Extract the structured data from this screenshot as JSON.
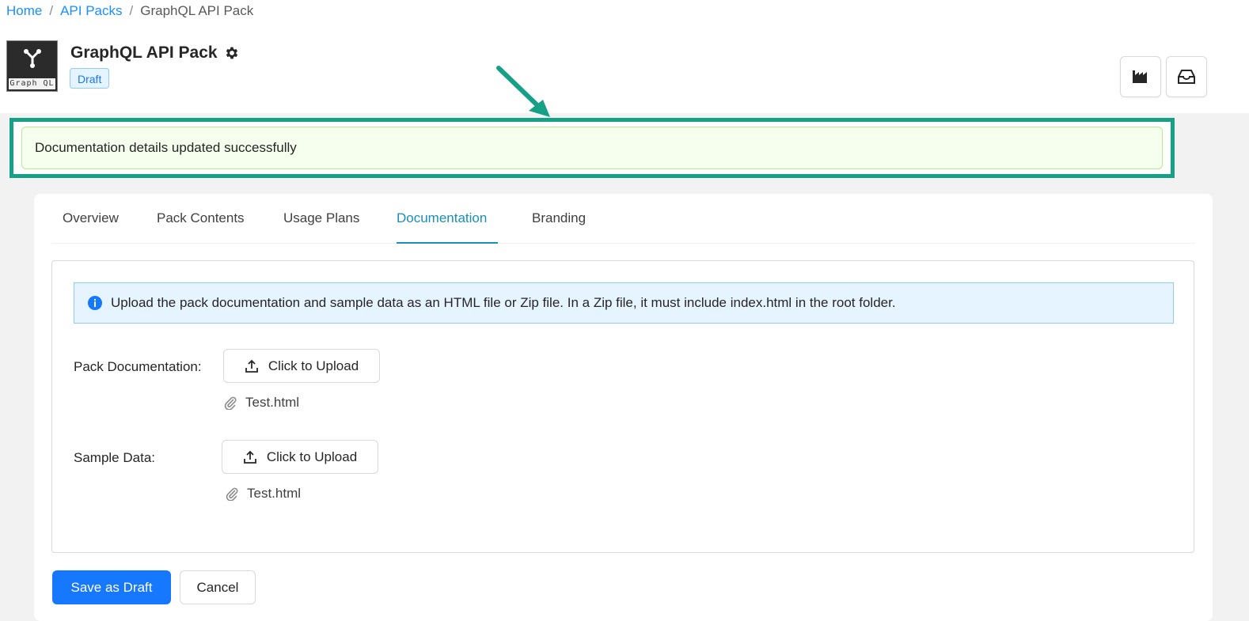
{
  "breadcrumb": {
    "home": "Home",
    "api_packs": "API Packs",
    "current": "GraphQL API Pack",
    "separator": "/"
  },
  "header": {
    "logo_text": "Graph QL",
    "title": "GraphQL API Pack",
    "status": "Draft",
    "icons": [
      "settings-gear-icon",
      "factory-icon",
      "inbox-icon"
    ]
  },
  "alert": {
    "success_message": "Documentation details updated successfully"
  },
  "tabs": [
    {
      "label": "Overview"
    },
    {
      "label": "Pack Contents"
    },
    {
      "label": "Usage Plans"
    },
    {
      "label": "Documentation"
    },
    {
      "label": "Branding"
    }
  ],
  "active_tab": "Documentation",
  "info": {
    "message": "Upload the pack documentation and sample data as an HTML file or Zip file. In a Zip file, it must include index.html in the root folder."
  },
  "form": {
    "pack_documentation_label": "Pack Documentation:",
    "pack_documentation_button": "Click to Upload",
    "pack_documentation_file": "Test.html",
    "sample_data_label": "Sample Data:",
    "sample_data_button": "Click to Upload",
    "sample_data_file": "Test.html"
  },
  "actions": {
    "save_draft": "Save as Draft",
    "cancel": "Cancel"
  },
  "colors": {
    "primary": "#1677ff",
    "tab_active": "#1890b8",
    "highlight": "#16a085",
    "success_bg": "#f6ffed"
  }
}
